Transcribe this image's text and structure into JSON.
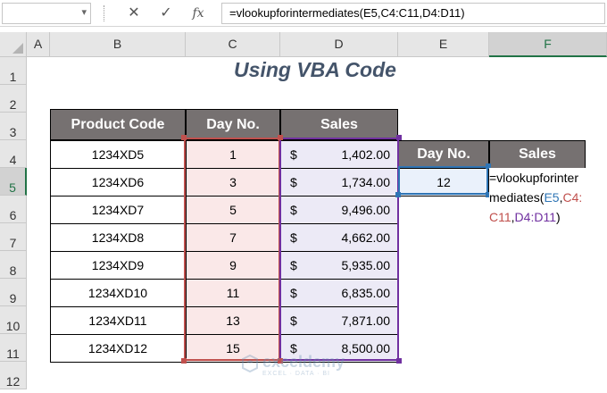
{
  "formula_bar": {
    "name_box": "",
    "cancel_icon": "✕",
    "enter_icon": "✓",
    "fx_label": "fx",
    "formula": "=vlookupforintermediates(E5,C4:C11,D4:D11)"
  },
  "columns": [
    "A",
    "B",
    "C",
    "D",
    "E",
    "F"
  ],
  "rows": [
    "1",
    "2",
    "3",
    "4",
    "5",
    "6",
    "7",
    "8",
    "9",
    "10",
    "11",
    "12"
  ],
  "title": "Using VBA Code",
  "table": {
    "headers": [
      "Product Code",
      "Day No.",
      "Sales"
    ],
    "rows": [
      {
        "code": "1234XD5",
        "day": "1",
        "currency": "$",
        "sales": "1,402.00"
      },
      {
        "code": "1234XD6",
        "day": "3",
        "currency": "$",
        "sales": "1,734.00"
      },
      {
        "code": "1234XD7",
        "day": "5",
        "currency": "$",
        "sales": "9,496.00"
      },
      {
        "code": "1234XD8",
        "day": "7",
        "currency": "$",
        "sales": "4,662.00"
      },
      {
        "code": "1234XD9",
        "day": "9",
        "currency": "$",
        "sales": "5,935.00"
      },
      {
        "code": "1234XD10",
        "day": "11",
        "currency": "$",
        "sales": "6,835.00"
      },
      {
        "code": "1234XD11",
        "day": "13",
        "currency": "$",
        "sales": "7,871.00"
      },
      {
        "code": "1234XD12",
        "day": "15",
        "currency": "$",
        "sales": "8,500.00"
      }
    ]
  },
  "lookup": {
    "day_header": "Day No.",
    "sales_header": "Sales",
    "day_value": "12",
    "edit_text": {
      "p1": "=vlookupforinter",
      "p2": "mediates(",
      "ref1": "E5",
      "sep1": ",",
      "ref2a": "C4:",
      "ref2b": "C11",
      "sep2": ",",
      "ref3": "D4:D11",
      "close": ")"
    }
  },
  "watermark": {
    "name": "exceldemy",
    "tagline": "EXCEL · DATA · BI"
  },
  "colors": {
    "header_fill": "#767171",
    "accent_green": "#217346",
    "ref_red": "#c0504d",
    "ref_purple": "#7030a0",
    "ref_blue": "#2f75b5"
  }
}
